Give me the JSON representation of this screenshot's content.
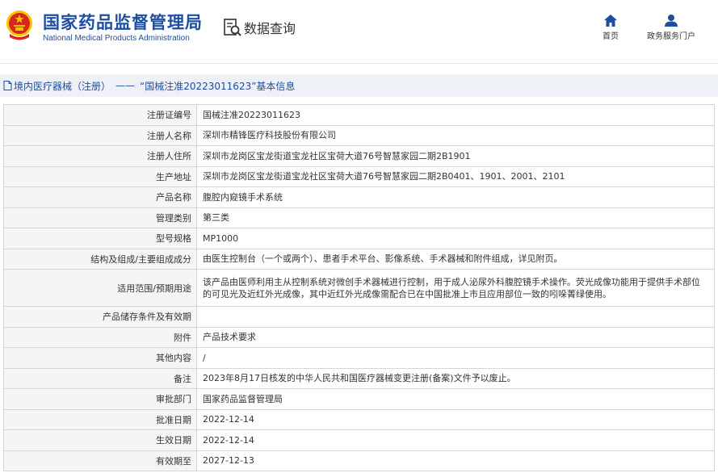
{
  "header": {
    "site_name_cn": "国家药品监督管理局",
    "site_name_en": "National Medical Products Administration",
    "query_label": "数据查询",
    "nav": [
      {
        "label": "首页",
        "icon": "home-icon"
      },
      {
        "label": "政务服务门户",
        "icon": "user-icon"
      }
    ]
  },
  "colors": {
    "brand_blue": "#1e4ea0",
    "emblem_red": "#d7261e",
    "emblem_gold": "#f5c400",
    "breadcrumb_bg": "#eef1f5"
  },
  "breadcrumb": {
    "section": "境内医疗器械（注册）",
    "separator": "——",
    "detail": "“国械注准20223011623”基本信息"
  },
  "rows": [
    {
      "label": "注册证编号",
      "value": "国械注准20223011623"
    },
    {
      "label": "注册人名称",
      "value": "深圳市精锋医疗科技股份有限公司"
    },
    {
      "label": "注册人住所",
      "value": "深圳市龙岗区宝龙街道宝龙社区宝荷大道76号智慧家园二期2B1901"
    },
    {
      "label": "生产地址",
      "value": "深圳市龙岗区宝龙街道宝龙社区宝荷大道76号智慧家园二期2B0401、1901、2001、2101"
    },
    {
      "label": "产品名称",
      "value": "腹腔内窥镜手术系统"
    },
    {
      "label": "管理类别",
      "value": "第三类"
    },
    {
      "label": "型号规格",
      "value": "MP1000"
    },
    {
      "label": "结构及组成/主要组成成分",
      "value": "由医生控制台（一个或两个）、患者手术平台、影像系统、手术器械和附件组成，详见附页。"
    },
    {
      "label": "适用范围/预期用途",
      "value": "该产品由医师利用主从控制系统对微创手术器械进行控制，用于成人泌尿外科腹腔镜手术操作。荧光成像功能用于提供手术部位的可见光及近红外光成像，其中近红外光成像需配合已在中国批准上市且应用部位一致的吲哚菁绿使用。",
      "tall": true
    },
    {
      "label": "产品储存条件及有效期",
      "value": ""
    },
    {
      "label": "附件",
      "value": "产品技术要求"
    },
    {
      "label": "其他内容",
      "value": "/"
    },
    {
      "label": "备注",
      "value": "2023年8月17日核发的中华人民共和国医疗器械变更注册(备案)文件予以废止。"
    },
    {
      "label": "审批部门",
      "value": "国家药品监督管理局"
    },
    {
      "label": "批准日期",
      "value": "2022-12-14"
    },
    {
      "label": "生效日期",
      "value": "2022-12-14"
    },
    {
      "label": "有效期至",
      "value": "2027-12-13"
    }
  ]
}
